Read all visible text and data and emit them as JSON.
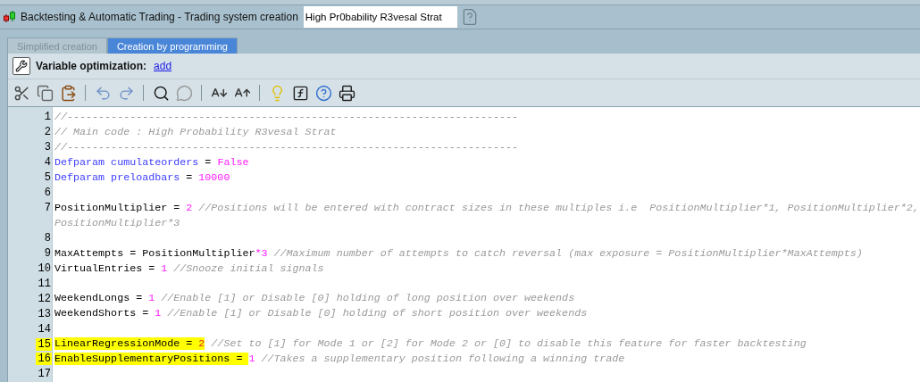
{
  "window": {
    "title": "Backtesting & Automatic Trading - Trading system creation"
  },
  "system_name": {
    "value": "High Pr0bability R3vesal Strat"
  },
  "tabs": [
    {
      "label": "Simplified creation",
      "selected": false
    },
    {
      "label": "Creation by programming",
      "selected": true
    }
  ],
  "optimization": {
    "label": "Variable optimization:",
    "link": "add"
  },
  "editor": {
    "lines": [
      {
        "number": "1",
        "highlighted": false,
        "tokens": [
          {
            "kind": "comment",
            "text": "//------------------------------------------------------------------------"
          }
        ]
      },
      {
        "number": "2",
        "highlighted": false,
        "tokens": [
          {
            "kind": "comment",
            "text": "// Main code : High Probability R3vesal Strat"
          }
        ]
      },
      {
        "number": "3",
        "highlighted": false,
        "tokens": [
          {
            "kind": "comment",
            "text": "//------------------------------------------------------------------------"
          }
        ]
      },
      {
        "number": "4",
        "highlighted": false,
        "tokens": [
          {
            "kind": "keyword",
            "text": "Defparam cumulateorders"
          },
          {
            "kind": "operator",
            "text": " = "
          },
          {
            "kind": "number",
            "text": "False"
          }
        ]
      },
      {
        "number": "5",
        "highlighted": false,
        "tokens": [
          {
            "kind": "keyword",
            "text": "Defparam preloadbars"
          },
          {
            "kind": "operator",
            "text": " = "
          },
          {
            "kind": "number",
            "text": "10000"
          }
        ]
      },
      {
        "number": "6",
        "highlighted": false
      },
      {
        "number": "7",
        "highlighted": false,
        "tokens": [
          {
            "kind": "ident",
            "text": "PositionMultiplier"
          },
          {
            "kind": "operator",
            "text": " = "
          },
          {
            "kind": "number",
            "text": "2"
          },
          {
            "kind": "comment",
            "text": " //Positions will be entered with contract sizes in these multiples i.e  PositionMultiplier*1, PositionMultiplier*2,"
          }
        ],
        "continuation": "PositionMultiplier*3"
      },
      {
        "number": "8",
        "highlighted": false
      },
      {
        "number": "9",
        "highlighted": false,
        "tokens": [
          {
            "kind": "ident",
            "text": "MaxAttempts"
          },
          {
            "kind": "operator",
            "text": " = "
          },
          {
            "kind": "ident",
            "text": "PositionMultiplier"
          },
          {
            "kind": "number",
            "text": "*3"
          },
          {
            "kind": "comment",
            "text": " //Maximum number of attempts to catch reversal (max exposure = PositionMultiplier*MaxAttempts)"
          }
        ]
      },
      {
        "number": "10",
        "highlighted": false,
        "tokens": [
          {
            "kind": "ident",
            "text": "VirtualEntries"
          },
          {
            "kind": "operator",
            "text": " = "
          },
          {
            "kind": "number",
            "text": "1"
          },
          {
            "kind": "comment",
            "text": " //Snooze initial signals"
          }
        ]
      },
      {
        "number": "11",
        "highlighted": false
      },
      {
        "number": "12",
        "highlighted": false,
        "tokens": [
          {
            "kind": "ident",
            "text": "WeekendLongs"
          },
          {
            "kind": "operator",
            "text": " = "
          },
          {
            "kind": "number",
            "text": "1"
          },
          {
            "kind": "comment",
            "text": " //Enable [1] or Disable [0] holding of long position over weekends"
          }
        ]
      },
      {
        "number": "13",
        "highlighted": false,
        "tokens": [
          {
            "kind": "ident",
            "text": "WeekendShorts"
          },
          {
            "kind": "operator",
            "text": " = "
          },
          {
            "kind": "number",
            "text": "1"
          },
          {
            "kind": "comment",
            "text": " //Enable [1] or Disable [0] holding of short position over weekends"
          }
        ]
      },
      {
        "number": "14",
        "highlighted": false
      },
      {
        "number": "15",
        "highlighted": true,
        "tokens": [
          {
            "kind": "ident",
            "text": "LinearRegressionMode"
          },
          {
            "kind": "operator",
            "text": " = "
          },
          {
            "kind": "accent",
            "text": "2"
          },
          {
            "kind": "comment",
            "text": " //Set to [1] for Mode 1 or [2] for Mode 2 or [0] to disable this feature for faster backtesting"
          }
        ]
      },
      {
        "number": "16",
        "highlighted": true,
        "tokens": [
          {
            "kind": "ident",
            "text": "EnableSupplementaryPositions"
          },
          {
            "kind": "operator",
            "text": " = "
          },
          {
            "kind": "number",
            "text": "1"
          },
          {
            "kind": "comment",
            "text": " //Takes a supplementary position following a winning trade"
          }
        ]
      },
      {
        "number": "17",
        "highlighted": false
      }
    ]
  }
}
